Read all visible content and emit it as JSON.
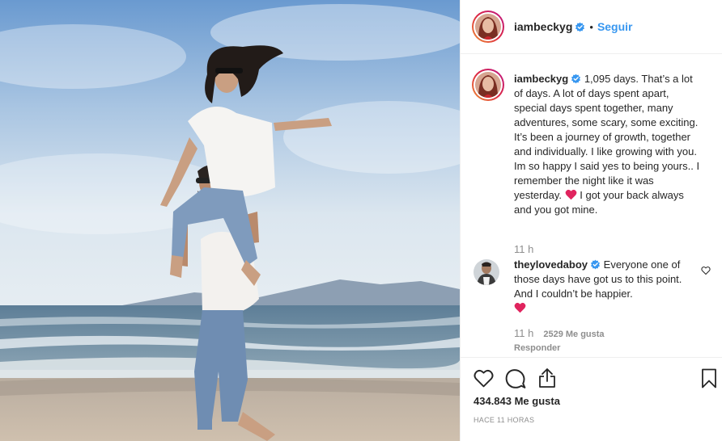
{
  "header": {
    "username": "iambeckyg",
    "separator": "•",
    "follow_label": "Seguir"
  },
  "caption": {
    "username": "iambeckyg",
    "text_part1": " 1,095 days. That’s a lot of days. A lot of days spent apart, special days spent together, many adventures, some scary, some exciting. It’s been a journey of growth, together and individually. I like growing with you. Im so happy I said yes to being yours.. I remember the night like it was yesterday. ",
    "text_part2": " I got your back always and you got mine.",
    "emoji": "red-heart",
    "time": "11 h"
  },
  "comment": {
    "username": "theylovedaboy",
    "text": " Everyone one of those days have got us to this point. And I couldn’t be happier.",
    "emoji": "red-heart",
    "time": "11 h",
    "likes": "2529 Me gusta",
    "reply_label": "Responder"
  },
  "footer": {
    "likes": "434.843 Me gusta",
    "ago": "HACE 11 HORAS"
  },
  "colors": {
    "accent": "#3897f0",
    "heart": "#e0245e",
    "muted": "#8e8e8e"
  },
  "icons": [
    "verified-badge-icon",
    "heart-icon",
    "comment-icon",
    "share-icon",
    "bookmark-icon",
    "like-comment-icon"
  ]
}
